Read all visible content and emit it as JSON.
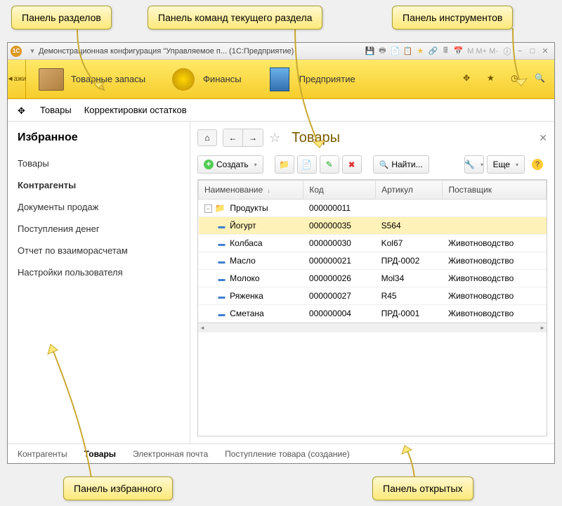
{
  "callouts": {
    "sections": "Панель разделов",
    "commands": "Панель команд текущего раздела",
    "tools": "Панель инструментов",
    "favorites": "Панель избранного",
    "open": "Панель открытых"
  },
  "titlebar": {
    "logo": "1С",
    "title": "Демонстрационная конфигурация \"Управляемое п...  (1С:Предприятие)",
    "mgroup": "M  M+  M-"
  },
  "sections": {
    "nav": "ажи",
    "items": [
      {
        "label": "Товарные запасы"
      },
      {
        "label": "Финансы"
      },
      {
        "label": "Предприятие"
      }
    ]
  },
  "cmdbar": {
    "items": [
      "Товары",
      "Корректировки остатков"
    ]
  },
  "favorites": {
    "title": "Избранное",
    "items": [
      {
        "label": "Товары",
        "active": false
      },
      {
        "label": "Контрагенты",
        "active": true
      },
      {
        "label": "Документы продаж",
        "active": false
      },
      {
        "label": "Поступления денег",
        "active": false
      },
      {
        "label": "Отчет по взаиморасчетам",
        "active": false
      },
      {
        "label": "Настройки пользователя",
        "active": false
      }
    ]
  },
  "main": {
    "title": "Товары",
    "toolbar": {
      "create": "Создать",
      "find": "Найти...",
      "more": "Еще"
    },
    "columns": {
      "name": "Наименование",
      "code": "Код",
      "sku": "Артикул",
      "supplier": "Поставщик"
    },
    "rows": [
      {
        "type": "folder",
        "name": "Продукты",
        "code": "000000011",
        "sku": "",
        "supplier": ""
      },
      {
        "type": "item",
        "selected": true,
        "name": "Йогурт",
        "code": "000000035",
        "sku": "S564",
        "supplier": ""
      },
      {
        "type": "item",
        "name": "Колбаса",
        "code": "000000030",
        "sku": "Kol67",
        "supplier": "Животноводство"
      },
      {
        "type": "item",
        "name": "Масло",
        "code": "000000021",
        "sku": "ПРД-0002",
        "supplier": "Животноводство"
      },
      {
        "type": "item",
        "name": "Молоко",
        "code": "000000026",
        "sku": "Mol34",
        "supplier": "Животноводство"
      },
      {
        "type": "item",
        "name": "Ряженка",
        "code": "000000027",
        "sku": "R45",
        "supplier": "Животноводство"
      },
      {
        "type": "item",
        "name": "Сметана",
        "code": "000000004",
        "sku": "ПРД-0001",
        "supplier": "Животноводство"
      }
    ]
  },
  "openpanel": {
    "tabs": [
      {
        "label": "Контрагенты",
        "active": false
      },
      {
        "label": "Товары",
        "active": true
      },
      {
        "label": "Электронная почта",
        "active": false
      },
      {
        "label": "Поступление товара (создание)",
        "active": false
      }
    ]
  }
}
